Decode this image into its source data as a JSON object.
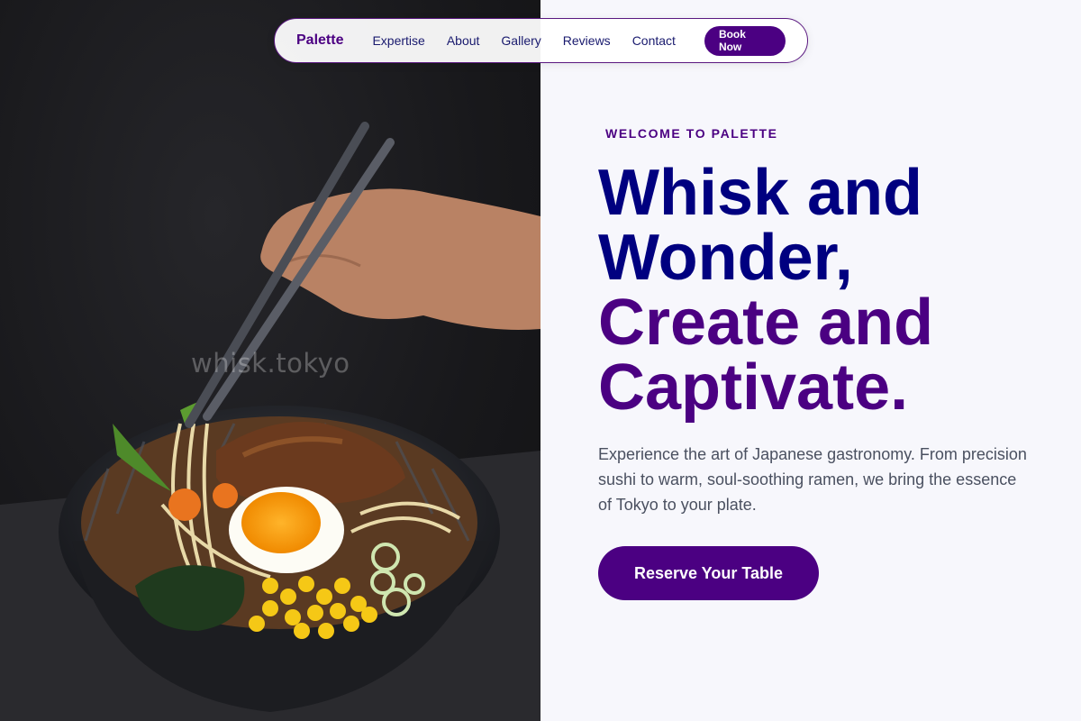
{
  "nav": {
    "brand": "Palette",
    "links": [
      "Expertise",
      "About",
      "Gallery",
      "Reviews",
      "Contact"
    ],
    "cta_label": "Book Now"
  },
  "photo": {
    "watermark": "whisk.tokyo"
  },
  "hero": {
    "eyebrow": "WELCOME TO PALETTE",
    "headline_line1": "Whisk and",
    "headline_line2": "Wonder,",
    "headline_line3": "Create and",
    "headline_line4": "Captivate.",
    "description": "Experience the art of Japanese gastronomy. From precision sushi to warm, soul-soothing ramen, we bring the essence of Tokyo to your plate.",
    "cta_label": "Reserve Your Table"
  },
  "colors": {
    "brand_purple": "#4b0082",
    "navy": "#000080",
    "page_background": "#f7f7fc",
    "photo_background": "#18181b"
  }
}
